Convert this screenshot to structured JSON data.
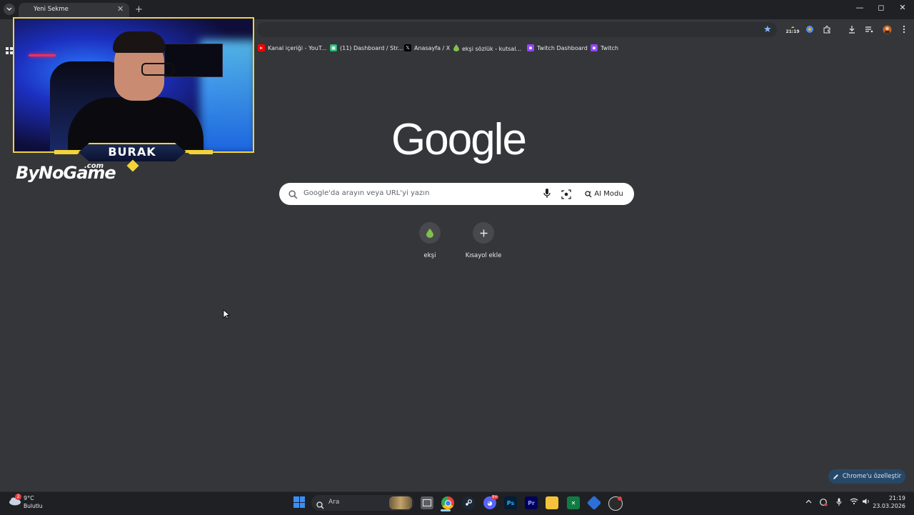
{
  "browser": {
    "tab_title": "Yeni Sekme",
    "tab_close": "✕",
    "new_tab": "+",
    "window_controls": [
      "—",
      "◻",
      "✕"
    ],
    "extensions_time": "21:19"
  },
  "bookmarks": [
    {
      "label": "Kanal içeriği - YouT...",
      "icon": "youtube-icon",
      "color": "#ff0000"
    },
    {
      "label": "(11) Dashboard / Str...",
      "icon": "streamer-icon",
      "color": "#2bb673"
    },
    {
      "label": "Anasayfa / X",
      "icon": "x-icon",
      "color": "#000000"
    },
    {
      "label": "ekşi sözlük - kutsal...",
      "icon": "eksi-icon",
      "color": "#81c14b"
    },
    {
      "label": "Twitch Dashboard",
      "icon": "twitch-icon",
      "color": "#9146ff"
    },
    {
      "label": "Twitch",
      "icon": "twitch-icon",
      "color": "#9146ff"
    }
  ],
  "overlay": {
    "name": "BURAK",
    "brand": "ByNoGame",
    "brand_suffix": ".com"
  },
  "google": {
    "logo": "Google",
    "search_placeholder": "Google'da arayın veya URL'yi yazın",
    "ai_mode": "AI Modu"
  },
  "shortcuts": [
    {
      "label": "ekşi",
      "icon": "eksi-drop-icon"
    },
    {
      "label": "Kısayol ekle",
      "icon": "plus-icon"
    }
  ],
  "customize_button": "Chrome'u özelleştir",
  "taskbar": {
    "weather_temp": "9°C",
    "weather_cond": "Bulutlu",
    "weather_badge": "2",
    "search_label": "Ara",
    "clock_time": "21:19",
    "clock_date": "23.03.2026",
    "apps": [
      "file-explorer-icon",
      "chrome-icon",
      "steam-icon",
      "discord-icon",
      "photoshop-icon",
      "premiere-icon",
      "folder-icon",
      "excel-icon",
      "app-icon",
      "obs-icon"
    ],
    "ps_label": "Ps",
    "pr_label": "Pr",
    "discord_badge": "9+"
  },
  "colors": {
    "page_bg": "#35363a",
    "accent": "#8ab4f8",
    "overlay_border": "#f2d33a"
  }
}
